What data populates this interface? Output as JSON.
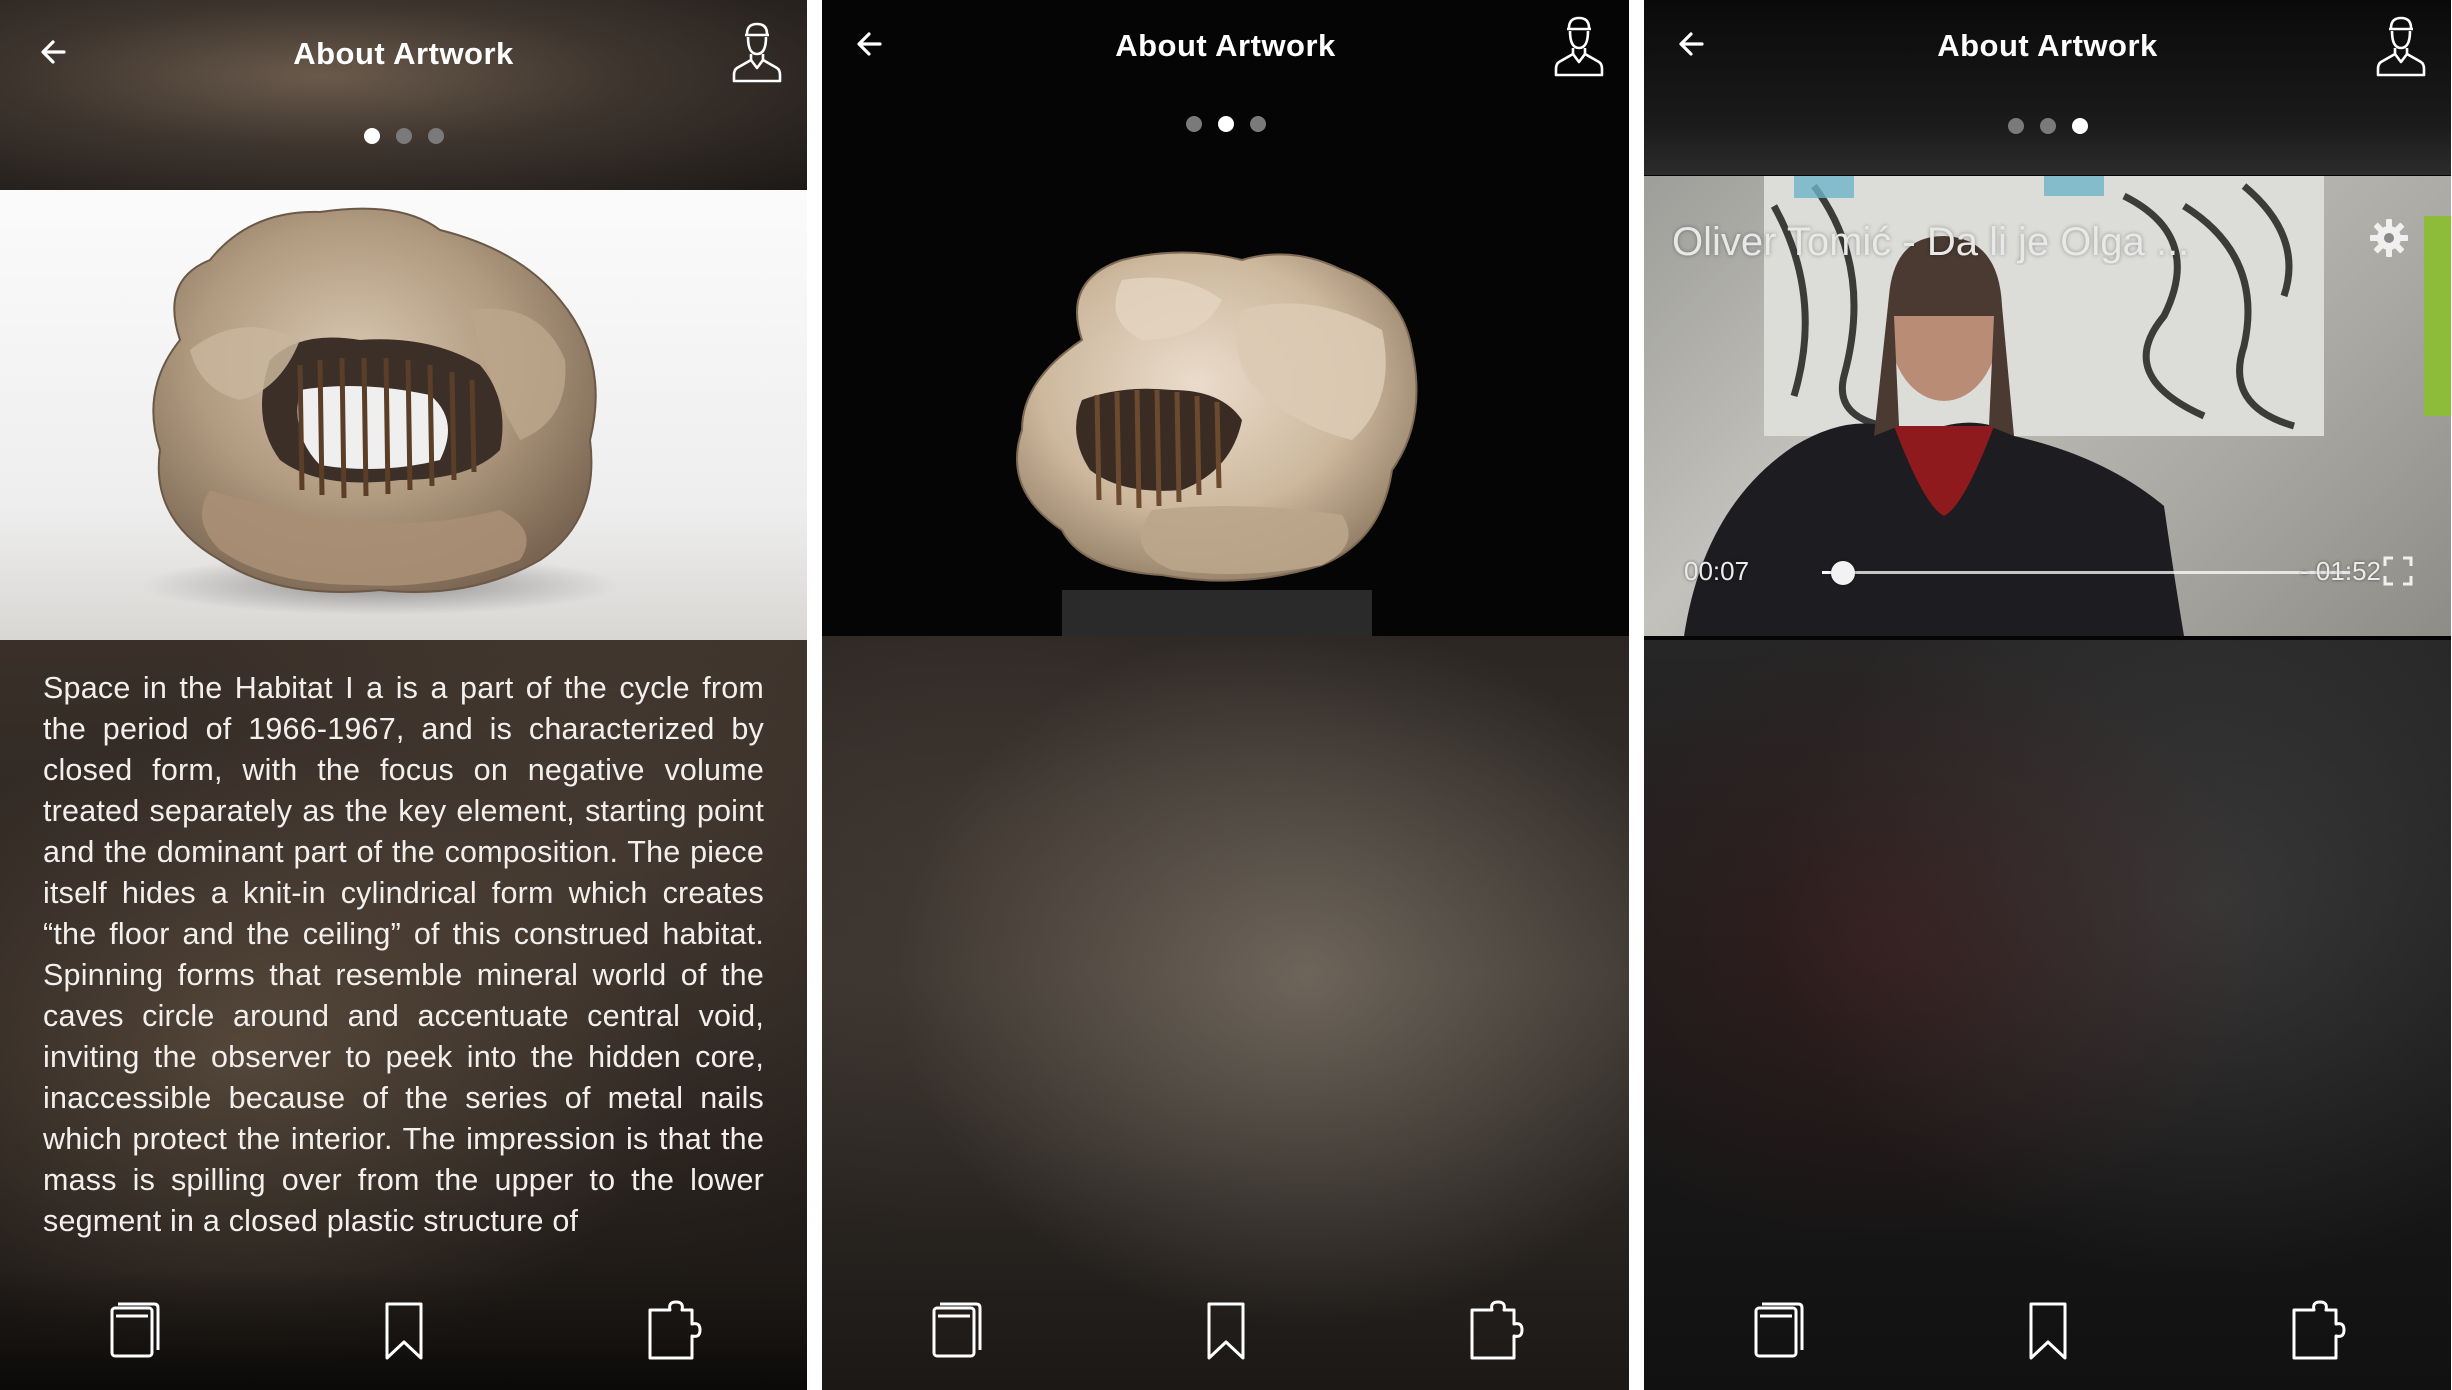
{
  "screens": [
    {
      "header": {
        "title": "About Artwork"
      },
      "pager": {
        "count": 3,
        "active": 0
      },
      "description": "Space in the Habitat I a is a part of the cycle from the period of 1966-1967, and is characterized by closed form, with the focus on negative volume treated separately as the key element, starting point and the dominant part of the composition. The piece itself hides a knit-in cylindrical form which creates “the floor and the ceiling” of this construed habitat. Spinning forms that resemble mineral world of the caves circle around and accentuate central void, inviting the observer to peek into the hidden core, inaccessible because of the series of metal nails which protect the interior. The impression is that the mass is spilling over from the upper to the lower segment in a closed plastic structure of"
    },
    {
      "header": {
        "title": "About Artwork"
      },
      "pager": {
        "count": 3,
        "active": 1
      }
    },
    {
      "header": {
        "title": "About Artwork"
      },
      "pager": {
        "count": 3,
        "active": 2
      },
      "video": {
        "title": "Oliver Tomić  - Da li je Olga ...",
        "current_time": "00:07",
        "remaining_time": "- 01:52",
        "progress_fraction": 0.04
      }
    }
  ],
  "icons": {
    "back": "back-arrow-icon",
    "profile": "user-profile-icon",
    "nav": [
      "notes-icon",
      "bookmark-icon",
      "puzzle-icon"
    ],
    "settings": "gear-icon",
    "fullscreen": "fullscreen-icon"
  },
  "colors": {
    "text": "#ffffff",
    "dot_inactive": "#7a7a7a",
    "dot_active": "#ffffff"
  }
}
